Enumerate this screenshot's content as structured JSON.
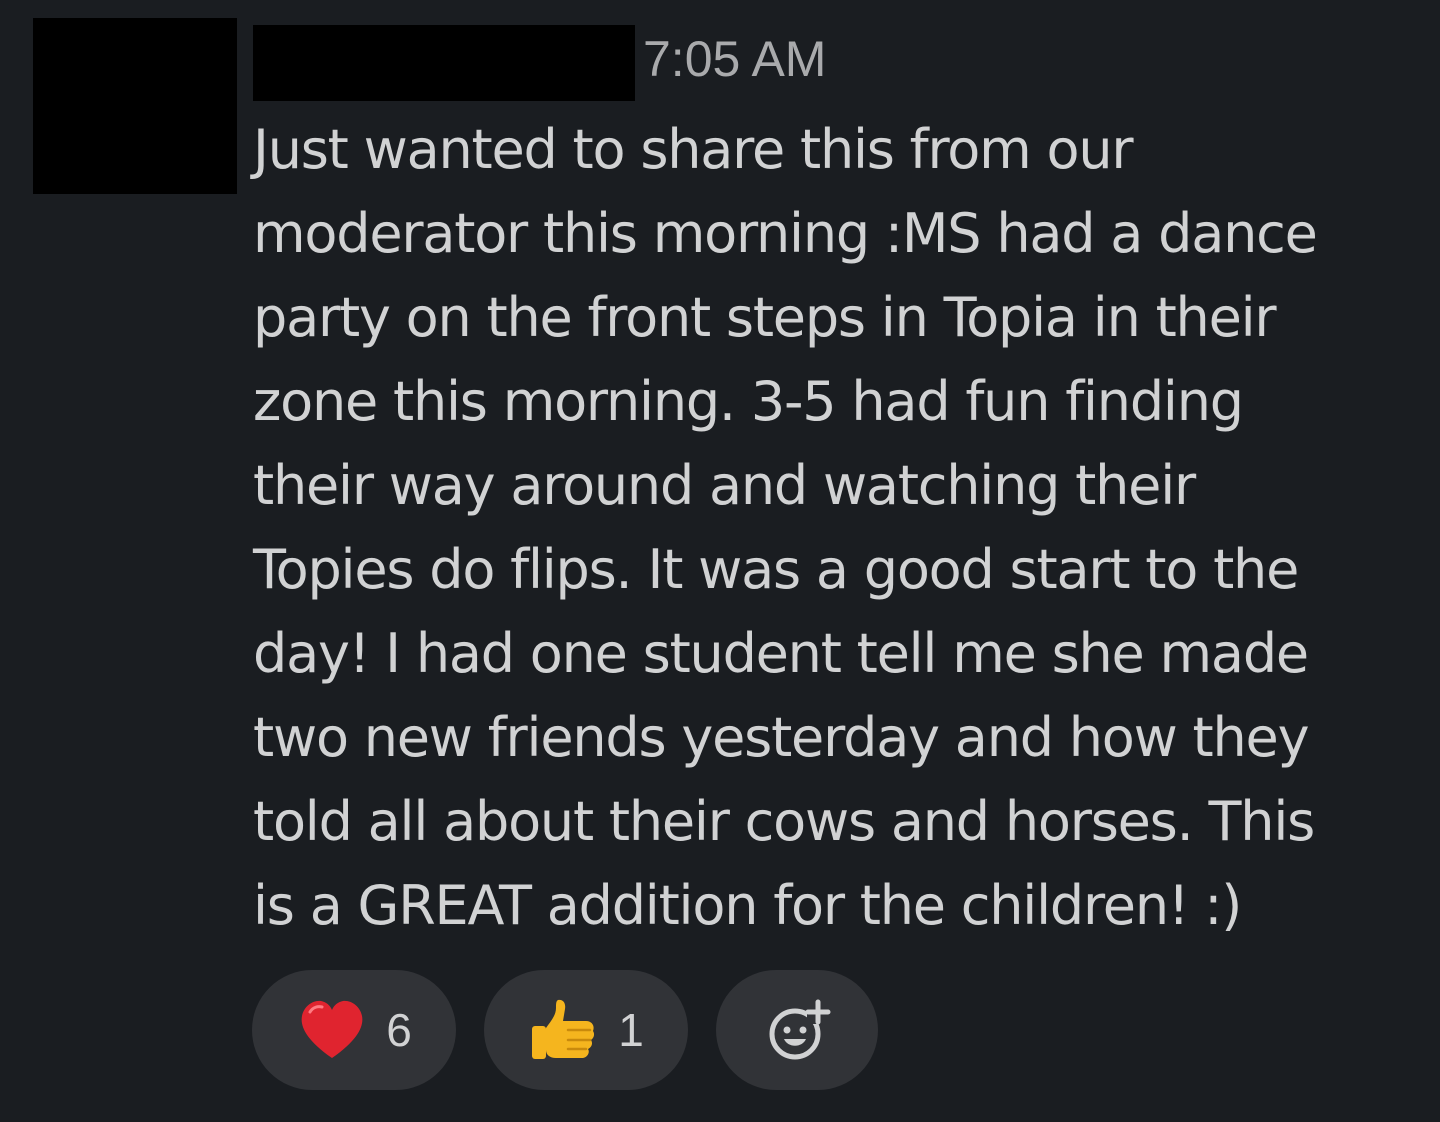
{
  "message": {
    "timestamp": "7:05 AM",
    "lines": [
      "Just wanted to share this from our",
      "moderator this morning :MS had a dance",
      "party on the front steps in Topia in their",
      "zone this morning. 3-5 had fun finding",
      "their way around and watching their",
      "Topies do flips. It was a good start to the",
      "day! I had one student tell me she made",
      "two new friends yesterday and how they",
      "told all about their cows and horses. This",
      "is a GREAT addition for the children! :)"
    ]
  },
  "reactions": [
    {
      "icon": "red-heart",
      "count": "6"
    },
    {
      "icon": "thumbs-up",
      "count": "1"
    },
    {
      "icon": "add-reaction"
    }
  ],
  "colors": {
    "background": "#1a1d21",
    "text": "#d1d2d3",
    "timestamp": "#a9aaac",
    "pill": "#313337",
    "heart": "#e0242f",
    "thumb": "#f5b51e"
  }
}
